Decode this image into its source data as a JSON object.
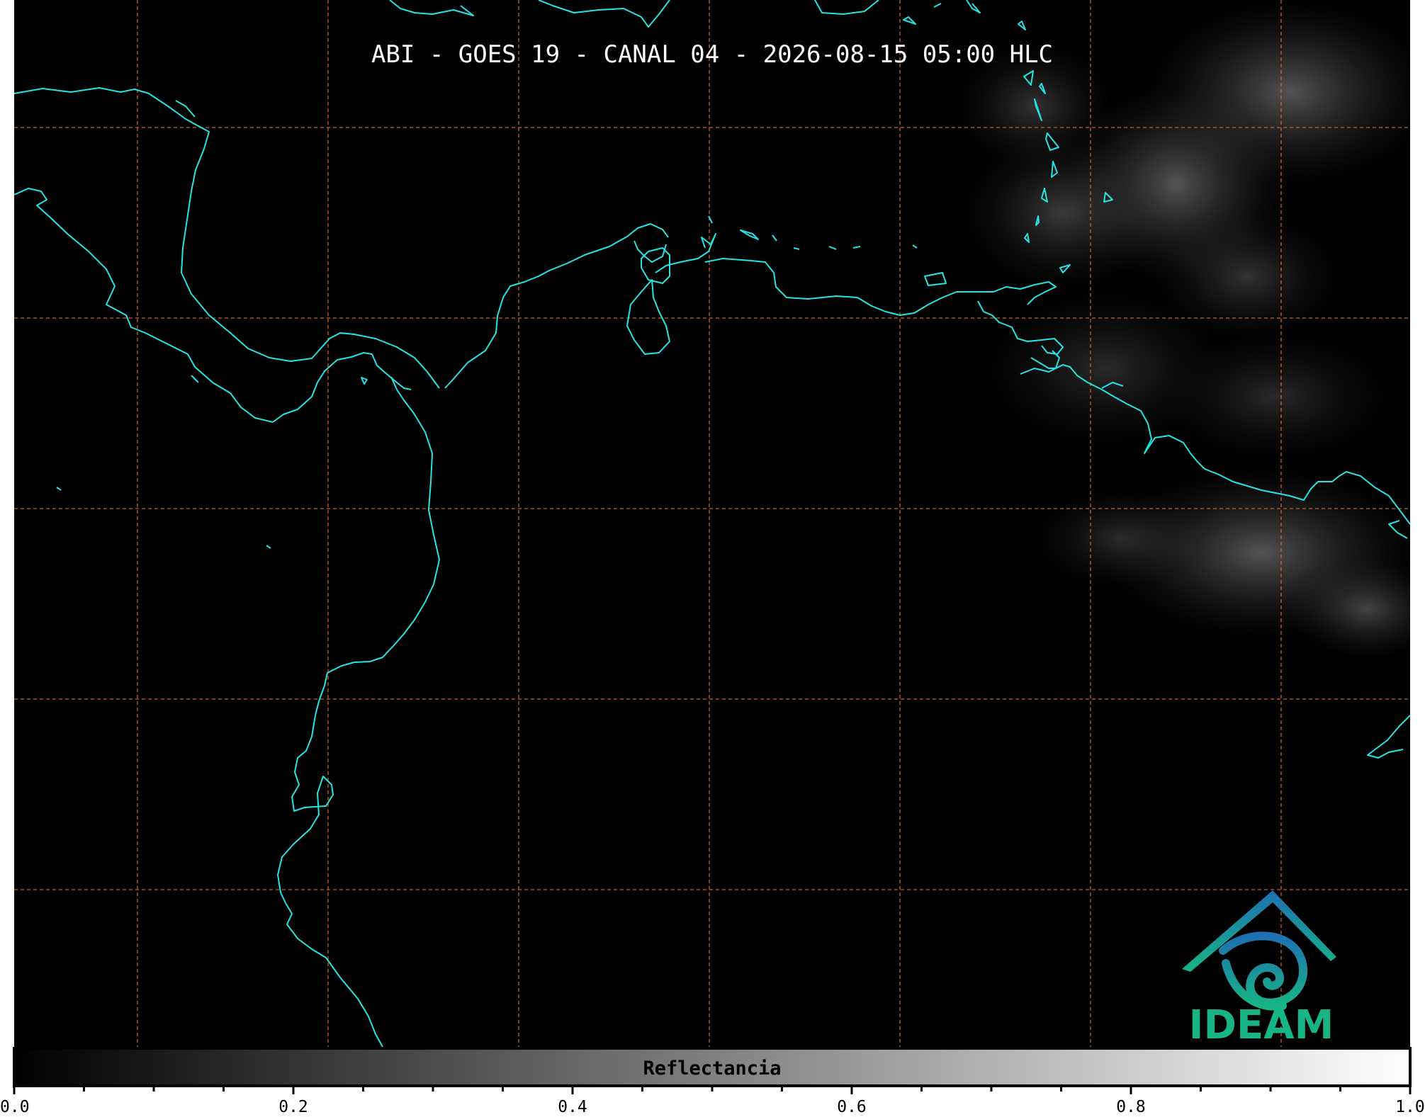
{
  "title": "ABI - GOES 19 - CANAL 04 - 2026-08-15 05:00 HLC",
  "colorbar": {
    "label": "Reflectancia",
    "range": [
      0.0,
      1.0
    ],
    "major_ticks": [
      "0.0",
      "0.2",
      "0.4",
      "0.6",
      "0.8",
      "1.0"
    ],
    "minor_tick_step": 0.05,
    "gradient_from": "#000000",
    "gradient_to": "#ffffff"
  },
  "logo": {
    "text": "IDEAM",
    "color_top": "#1f6fb2",
    "color_bottom": "#17b585"
  },
  "map": {
    "background": "#000000",
    "coastline_color": "#22e5e5",
    "gridline_color": "#c8642a",
    "gridline_style": "dashed"
  },
  "icons": {
    "logo": "ideam-logo-icon"
  }
}
